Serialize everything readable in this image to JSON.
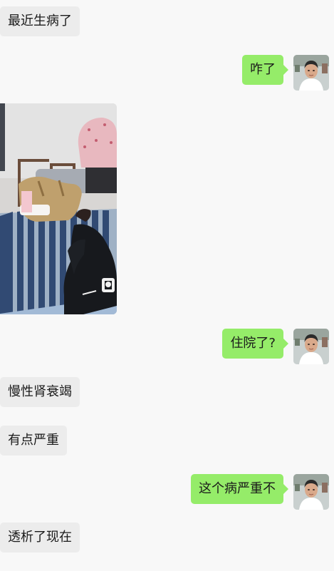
{
  "chat": {
    "messages": [
      {
        "sender": "other",
        "type": "text",
        "text": "最近生病了"
      },
      {
        "sender": "me",
        "type": "text",
        "text": "咋了",
        "avatar": "user-avatar-icon"
      },
      {
        "sender": "other",
        "type": "image",
        "image": "hospital-bed-photo"
      },
      {
        "sender": "me",
        "type": "text",
        "text": "住院了?",
        "avatar": "user-avatar-icon"
      },
      {
        "sender": "other",
        "type": "text",
        "text": "慢性肾衰竭"
      },
      {
        "sender": "other",
        "type": "text",
        "text": "有点严重"
      },
      {
        "sender": "me",
        "type": "text",
        "text": "这个病严重不",
        "avatar": "user-avatar-icon"
      },
      {
        "sender": "other",
        "type": "text",
        "text": "透析了现在"
      }
    ]
  },
  "colors": {
    "background": "#f8f8f8",
    "incoming_bubble": "#ececec",
    "outgoing_bubble": "#95ec69"
  }
}
